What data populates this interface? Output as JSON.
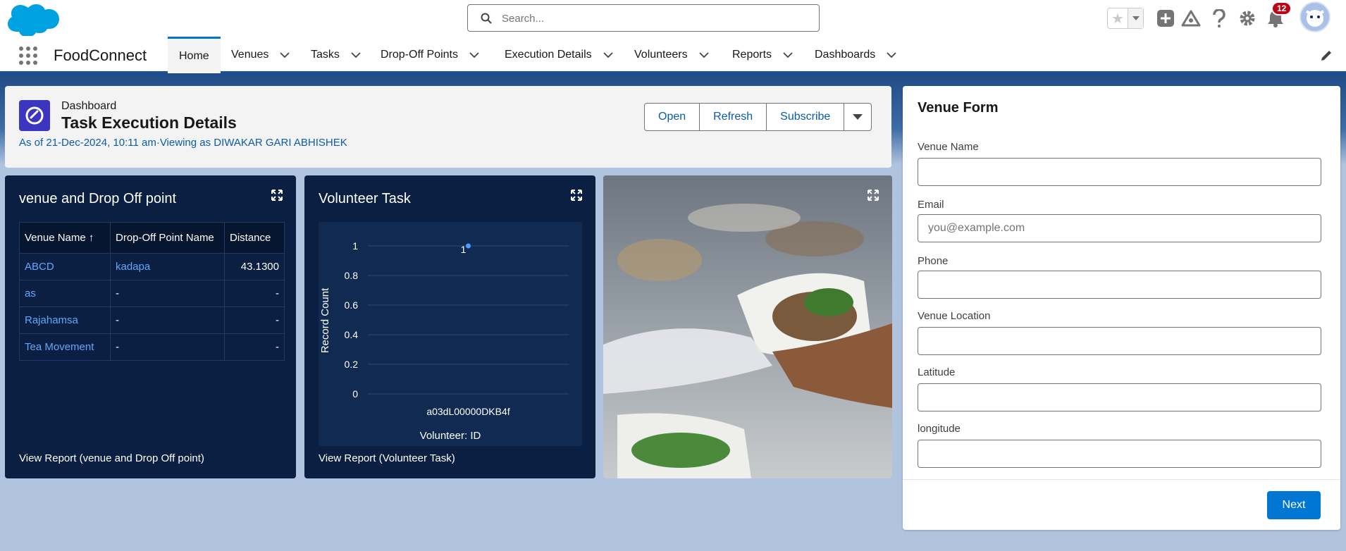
{
  "header": {
    "search_placeholder": "Search...",
    "notification_count": "12"
  },
  "nav": {
    "app_name": "FoodConnect",
    "items": [
      {
        "label": "Home"
      },
      {
        "label": "Venues"
      },
      {
        "label": "Tasks"
      },
      {
        "label": "Drop-Off Points"
      },
      {
        "label": "Execution Details"
      },
      {
        "label": "Volunteers"
      },
      {
        "label": "Reports"
      },
      {
        "label": "Dashboards"
      }
    ]
  },
  "dashboard": {
    "eyebrow": "Dashboard",
    "title": "Task Execution Details",
    "subtitle": "As of 21-Dec-2024, 10:11 am·Viewing as DIWAKAR GARI ABHISHEK",
    "buttons": {
      "open": "Open",
      "refresh": "Refresh",
      "subscribe": "Subscribe"
    }
  },
  "panel_table": {
    "title": "venue and Drop Off point",
    "columns": [
      "Venue Name ↑",
      "Drop-Off Point Name",
      "Distance"
    ],
    "rows": [
      [
        "ABCD",
        "kadapa",
        "43.1300"
      ],
      [
        "as",
        "-",
        "-"
      ],
      [
        "Rajahamsa",
        "-",
        "-"
      ],
      [
        "Tea Movement",
        "-",
        "-"
      ]
    ],
    "view_report": "View Report (venue and Drop Off point)"
  },
  "panel_chart": {
    "title": "Volunteer Task",
    "view_report": "View Report (Volunteer Task)"
  },
  "chart_data": {
    "type": "scatter",
    "title": "Volunteer Task",
    "xlabel": "Volunteer: ID",
    "ylabel": "Record Count",
    "categories": [
      "a03dL00000DKB4f"
    ],
    "values": [
      1
    ],
    "ylim": [
      0,
      1
    ],
    "yticks": [
      "1",
      "0.8",
      "0.6",
      "0.4",
      "0.2",
      "0"
    ],
    "data_labels": [
      "1"
    ],
    "point_color": "#4d9fff"
  },
  "form": {
    "title": "Venue Form",
    "fields": [
      {
        "label": "Venue Name",
        "placeholder": ""
      },
      {
        "label": "Email",
        "placeholder": "you@example.com"
      },
      {
        "label": "Phone",
        "placeholder": ""
      },
      {
        "label": "Venue Location",
        "placeholder": ""
      },
      {
        "label": "Latitude",
        "placeholder": ""
      },
      {
        "label": "longitude",
        "placeholder": ""
      }
    ],
    "next": "Next"
  },
  "colors": {
    "brand_blue": "#0176d3",
    "panel_navy": "#0b1f42",
    "badge_red": "#ba0517"
  }
}
